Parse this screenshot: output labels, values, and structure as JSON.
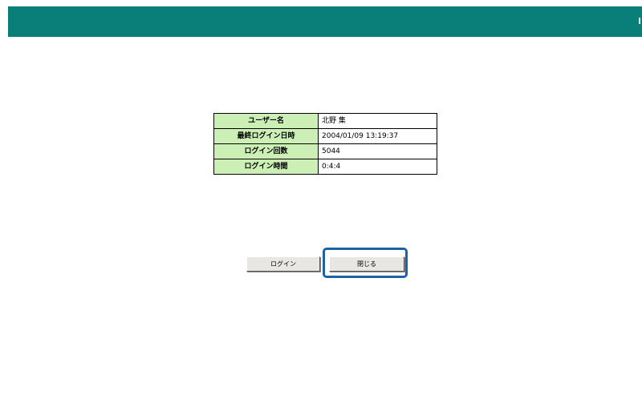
{
  "header": {
    "bar_color": "#0a7f7a"
  },
  "info": {
    "rows": [
      {
        "label": "ユーザー名",
        "value": "北野 集"
      },
      {
        "label": "最終ログイン日時",
        "value": "2004/01/09 13:19:37"
      },
      {
        "label": "ログイン回数",
        "value": "5044"
      },
      {
        "label": "ログイン時間",
        "value": "0:4:4"
      }
    ],
    "label_bg": "#ccefb6"
  },
  "buttons": {
    "login_label": "ログイン",
    "close_label": "閉じる"
  },
  "highlight": {
    "color": "#1b63a6",
    "target": "close-button"
  }
}
